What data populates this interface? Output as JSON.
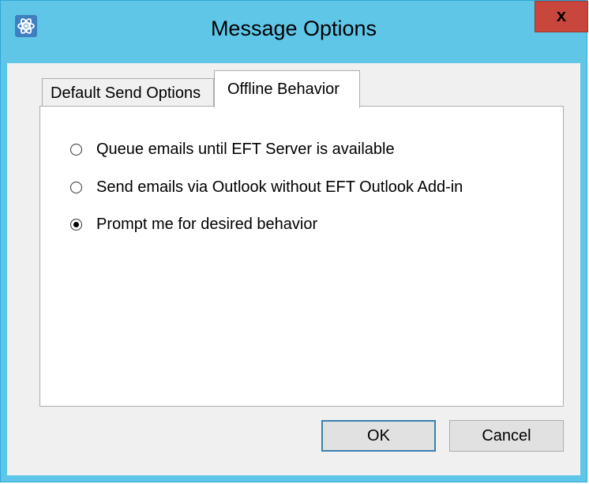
{
  "window": {
    "title": "Message Options",
    "close_glyph": "x",
    "app_icon": "atom-icon"
  },
  "tabs": [
    {
      "label": "Default Send Options",
      "selected": false
    },
    {
      "label": "Offline Behavior",
      "selected": true
    }
  ],
  "options": [
    {
      "label": "Queue emails until EFT Server is available",
      "checked": false
    },
    {
      "label": "Send emails via Outlook without EFT Outlook Add-in",
      "checked": false
    },
    {
      "label": "Prompt me for desired behavior",
      "checked": true
    }
  ],
  "buttons": {
    "ok": "OK",
    "cancel": "Cancel"
  },
  "colors": {
    "titlebar": "#5fc6e8",
    "close": "#c9463d",
    "dialog_bg": "#f0f0f0"
  }
}
